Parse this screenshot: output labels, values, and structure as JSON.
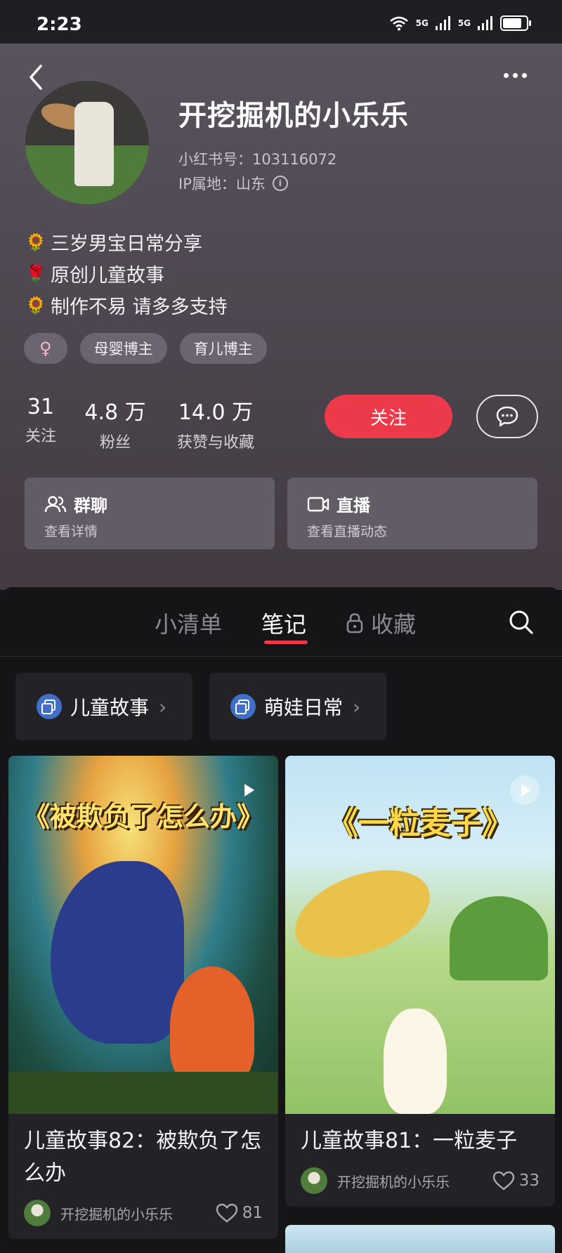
{
  "status_bar": {
    "time": "2:23",
    "net1": "5G",
    "net2": "5G"
  },
  "profile": {
    "username": "开挖掘机的小乐乐",
    "id_line": "小红书号：103116072",
    "ip_line": "IP属地：山东",
    "bio": [
      {
        "icon": "🌻",
        "text": "三岁男宝日常分享"
      },
      {
        "icon": "🌹",
        "text": "原创儿童故事"
      },
      {
        "icon": "🌻",
        "text": "制作不易 请多多支持"
      }
    ],
    "gender_symbol": "♀",
    "tags": [
      "母婴博主",
      "育儿博主"
    ],
    "stats": [
      {
        "value": "31",
        "label": "关注"
      },
      {
        "value": "4.8 万",
        "label": "粉丝"
      },
      {
        "value": "14.0 万",
        "label": "获赞与收藏"
      }
    ],
    "follow_label": "关注"
  },
  "cards": [
    {
      "title": "群聊",
      "sub": "查看详情",
      "icon": "group-chat-icon"
    },
    {
      "title": "直播",
      "sub": "查看直播动态",
      "icon": "live-camera-icon"
    }
  ],
  "tabs": [
    {
      "label": "小清单"
    },
    {
      "label": "笔记",
      "active": true
    },
    {
      "label": "收藏",
      "locked": true
    }
  ],
  "collections": [
    {
      "label": "儿童故事"
    },
    {
      "label": "萌娃日常"
    }
  ],
  "posts": [
    {
      "cover_text": "《被欺负了怎么办》",
      "title": "儿童故事82：被欺负了怎么办",
      "author": "开挖掘机的小乐乐",
      "likes": "81"
    },
    {
      "cover_text": "《一粒麦子》",
      "title": "儿童故事81：一粒麦子",
      "author": "开挖掘机的小乐乐",
      "likes": "33"
    }
  ],
  "colors": {
    "accent": "#ec3a4b",
    "bg": "#151518",
    "card": "#232327",
    "collection_icon": "#3f6fc8"
  }
}
